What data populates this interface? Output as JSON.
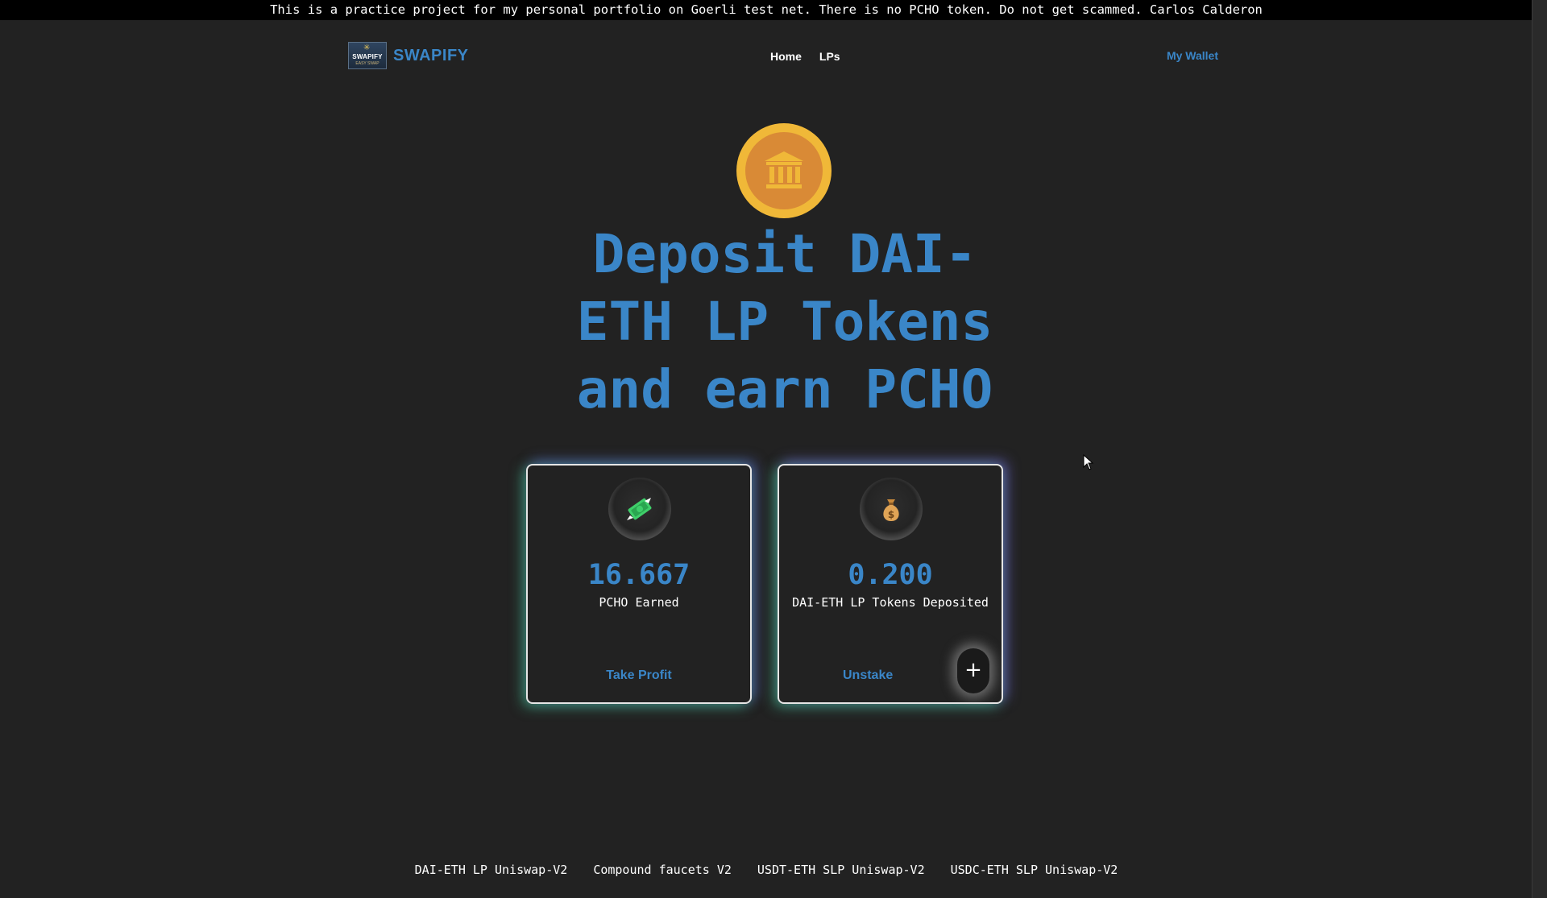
{
  "banner": {
    "text": "This is a practice project for my personal portfolio on Goerli test net. There is no PCHO token. Do not get scammed. Carlos Calderon"
  },
  "header": {
    "logo_word": "SWAPIFY",
    "logo_tagline": "EASY SWAP",
    "brand": "SWAPIFY",
    "nav": [
      {
        "label": "Home"
      },
      {
        "label": "LPs"
      }
    ],
    "wallet_label": "My Wallet"
  },
  "hero": {
    "icon": "bank-icon",
    "lines": [
      "Deposit DAI-",
      "ETH LP Tokens",
      "and earn PCHO"
    ]
  },
  "cards": [
    {
      "icon": "money-with-wings-icon",
      "value": "16.667",
      "label": "PCHO Earned",
      "action": "Take Profit"
    },
    {
      "icon": "money-bag-icon",
      "value": "0.200",
      "label": "DAI-ETH LP Tokens Deposited",
      "action": "Unstake",
      "plus": "+"
    }
  ],
  "footer": {
    "links": [
      "DAI-ETH LP Uniswap-V2",
      "Compound faucets V2",
      "USDT-ETH SLP Uniswap-V2",
      "USDC-ETH SLP Uniswap-V2"
    ]
  },
  "colors": {
    "background": "#222222",
    "accent": "#3a86c8",
    "coin_outer": "#f0b838",
    "coin_inner": "#d98a36"
  }
}
